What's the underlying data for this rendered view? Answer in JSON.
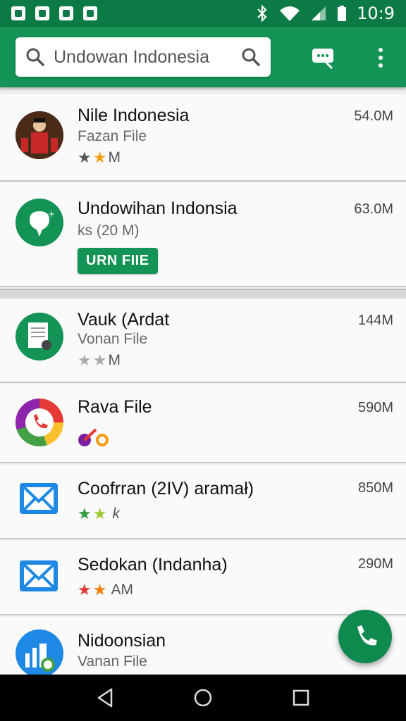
{
  "status_bar": {
    "time": "10:9",
    "icons": [
      "notification-icon",
      "notification-icon",
      "notification-icon",
      "notification-icon",
      "bluetooth-icon",
      "wifi-icon",
      "signal-icon",
      "battery-icon"
    ]
  },
  "app_bar": {
    "search_text": "Undowan Indonesia",
    "icons": [
      "search-icon",
      "chat-icon",
      "more-vert-icon"
    ],
    "brand_color": "#139355"
  },
  "items": [
    {
      "title": "Nile Indonesia",
      "subtitle": "Fazan File",
      "size": "54.0M",
      "rating_text": "M",
      "stars": 2
    },
    {
      "title": "Undowihan Indonsia",
      "subtitle": "ks (20 M)",
      "size": "63.0M",
      "button": "URN FIIE"
    },
    {
      "title": "Vauk (Ardat",
      "subtitle": "Vonan File",
      "size": "144M",
      "rating_text": "M",
      "stars": 2
    },
    {
      "title": "Rava File",
      "subtitle": "",
      "size": "590M"
    },
    {
      "title": "Coofrran (2IV) aramał)",
      "subtitle": "",
      "size": "850M",
      "rating_text": "k",
      "stars": 2
    },
    {
      "title": "Sedokan (Indanha)",
      "subtitle": "",
      "size": "290M",
      "rating_text": "AM",
      "stars": 2
    },
    {
      "title": "Nidoonsian",
      "subtitle": "Vanan File",
      "size": ""
    }
  ],
  "fab": {
    "icon": "phone-icon"
  },
  "nav_bar": {
    "icons": [
      "back-icon",
      "home-icon",
      "recents-icon"
    ]
  }
}
